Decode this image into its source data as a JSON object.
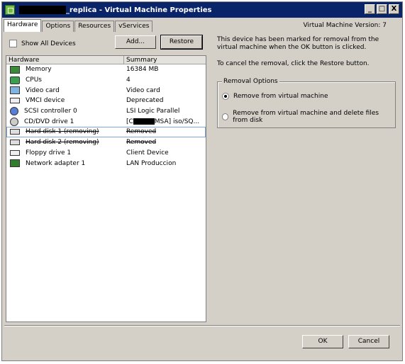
{
  "window": {
    "title_suffix": "_replica - Virtual Machine Properties",
    "minimize": "_",
    "maximize": "□",
    "close": "X"
  },
  "tabs": [
    "Hardware",
    "Options",
    "Resources",
    "vServices"
  ],
  "vm_version": "Virtual Machine Version: 7",
  "show_all_devices": "Show All Devices",
  "buttons": {
    "add": "Add...",
    "restore": "Restore",
    "ok": "OK",
    "cancel": "Cancel"
  },
  "hardware_table": {
    "headers": [
      "Hardware",
      "Summary"
    ],
    "rows": [
      {
        "name": "Memory",
        "summary": "16384 MB",
        "icon": "memory-icon"
      },
      {
        "name": "CPUs",
        "summary": "4",
        "icon": "cpu-icon"
      },
      {
        "name": "Video card",
        "summary": "Video card",
        "icon": "video-card-icon"
      },
      {
        "name": "VMCI device",
        "summary": "Deprecated",
        "icon": "vmci-icon"
      },
      {
        "name": "SCSI controller 0",
        "summary": "LSI Logic Parallel",
        "icon": "scsi-icon"
      },
      {
        "name": "CD/DVD drive 1",
        "summary": "[C",
        "summary_tail": "MSA] iso/SQ...",
        "icon": "cdrom-icon"
      },
      {
        "name": "Hard disk 1 (removing)",
        "summary": "Removed",
        "icon": "hard-disk-icon"
      },
      {
        "name": "Hard disk 2 (removing)",
        "summary": "Removed",
        "icon": "hard-disk-icon"
      },
      {
        "name": "Floppy drive 1",
        "summary": "Client Device",
        "icon": "floppy-icon"
      },
      {
        "name": "Network adapter 1",
        "summary": "LAN Produccion",
        "icon": "network-icon"
      }
    ]
  },
  "info": {
    "message": "This device has been marked for removal from the virtual machine when the OK button is clicked.",
    "cancel_hint": "To cancel the removal, click the Restore button."
  },
  "removal_options": {
    "title": "Removal Options",
    "option1": "Remove from virtual machine",
    "option2": "Remove from virtual machine and delete files from disk"
  }
}
